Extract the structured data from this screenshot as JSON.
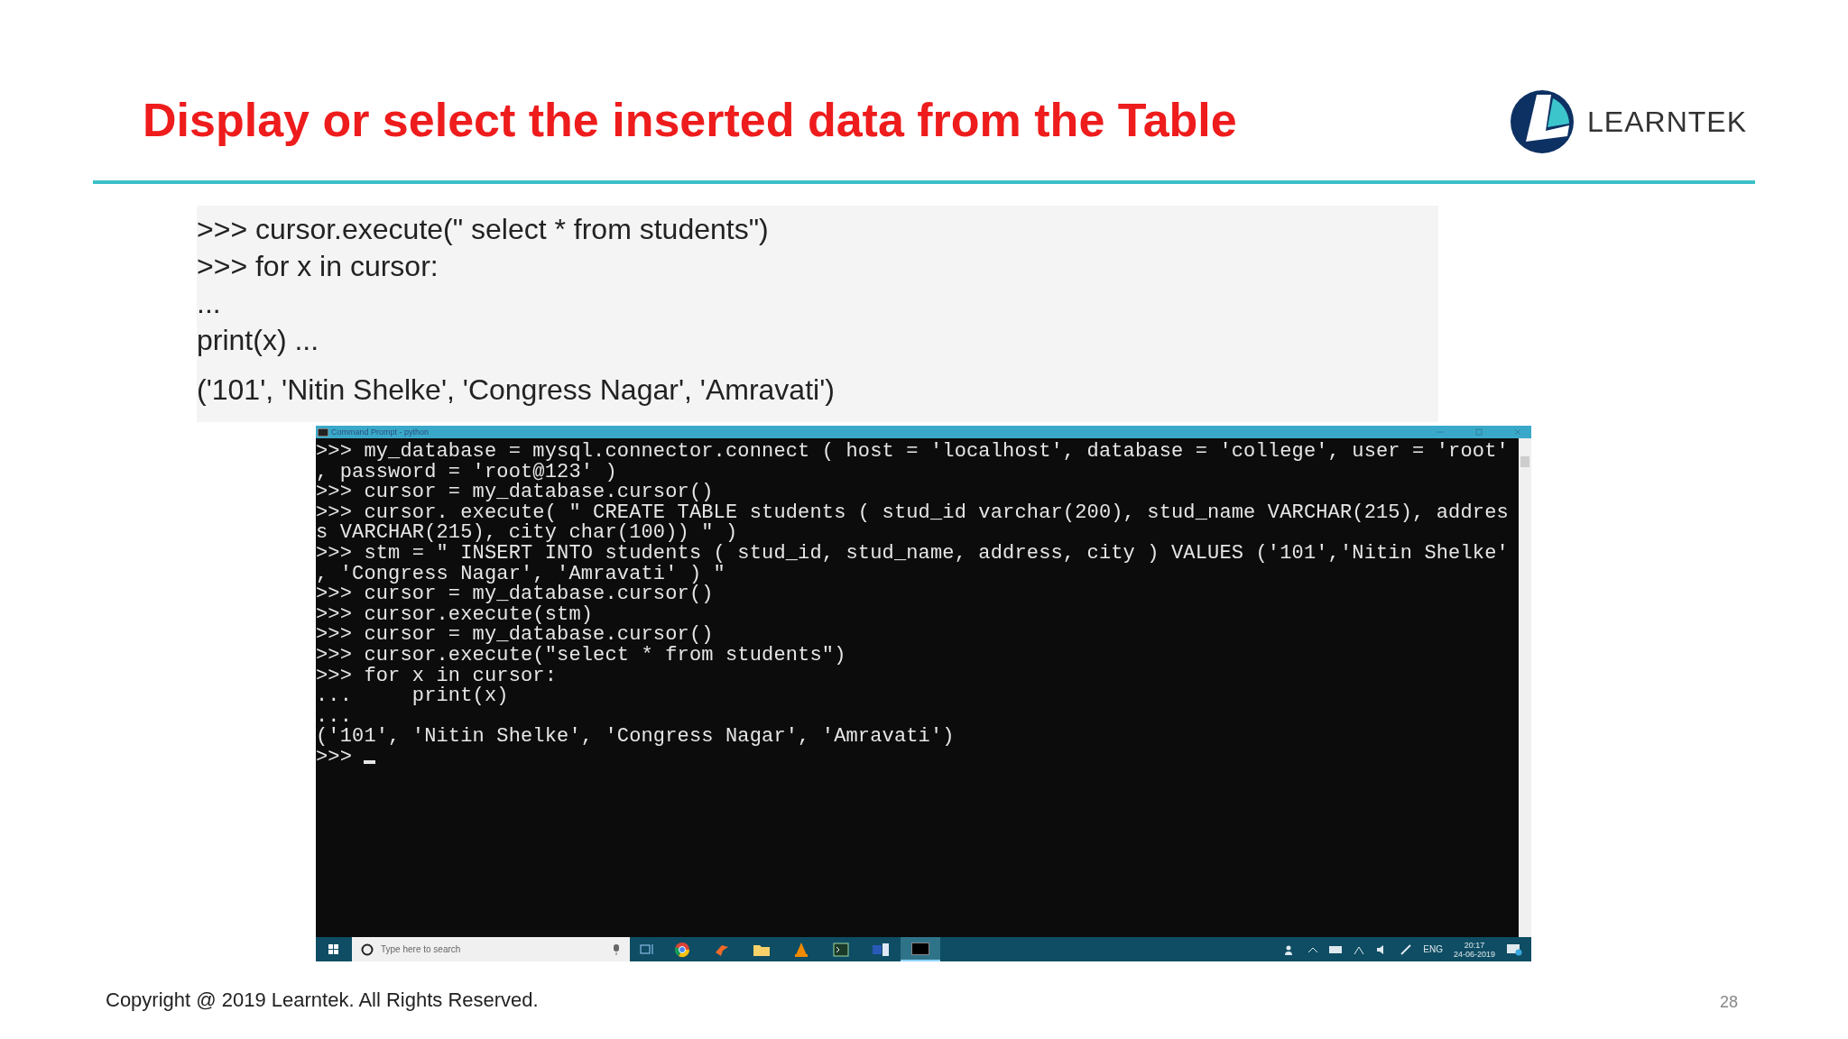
{
  "slide": {
    "title": "Display or select the inserted data from the Table",
    "logo_text": "LEARNTEK"
  },
  "code_box": {
    "lines": [
      ">>> cursor.execute(\" select * from students\")",
      ">>> for x in cursor:",
      "...",
      "print(x) ...",
      "('101', 'Nitin Shelke', 'Congress Nagar', 'Amravati')"
    ]
  },
  "terminal": {
    "title": "Command Prompt - python",
    "lines": [
      ">>> my_database = mysql.connector.connect ( host = 'localhost', database = 'college', user = 'root'",
      ", password = 'root@123' )",
      ">>> cursor = my_database.cursor()",
      ">>> cursor. execute( \" CREATE TABLE students ( stud_id varchar(200), stud_name VARCHAR(215), addres",
      "s VARCHAR(215), city char(100)) \" )",
      ">>> stm = \" INSERT INTO students ( stud_id, stud_name, address, city ) VALUES ('101','Nitin Shelke'",
      ", 'Congress Nagar', 'Amravati' ) \"",
      ">>> cursor = my_database.cursor()",
      ">>> cursor.execute(stm)",
      ">>> cursor = my_database.cursor()",
      ">>> cursor.execute(\"select * from students\")",
      ">>> for x in cursor:",
      "...     print(x)",
      "...",
      "('101', 'Nitin Shelke', 'Congress Nagar', 'Amravati')",
      ">>> "
    ]
  },
  "taskbar": {
    "search_placeholder": "Type here to search",
    "apps": [
      {
        "kind": "browser",
        "selected": false
      },
      {
        "kind": "paint",
        "selected": false
      },
      {
        "kind": "folder",
        "selected": false
      },
      {
        "kind": "cone",
        "selected": false
      },
      {
        "kind": "monitor",
        "selected": false
      },
      {
        "kind": "window",
        "selected": false
      },
      {
        "kind": "console",
        "selected": true
      }
    ],
    "language": "ENG",
    "time": "20:17",
    "date": "24-06-2019"
  },
  "footer": {
    "copyright": "Copyright @ 2019 Learntek. All Rights Reserved.",
    "page_number": "28"
  }
}
